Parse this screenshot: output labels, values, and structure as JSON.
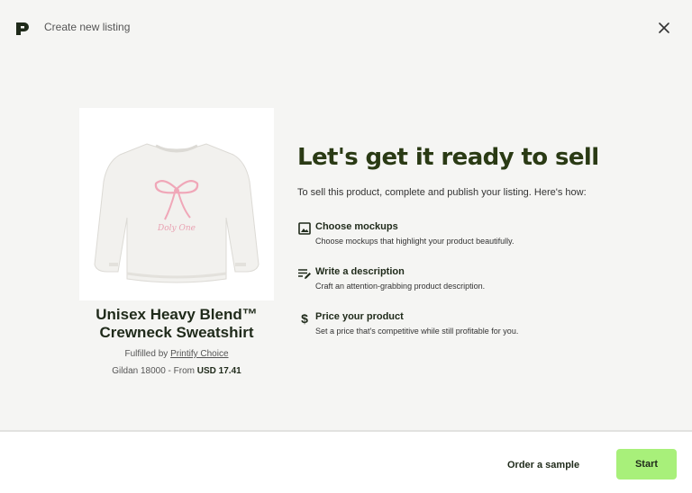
{
  "header": {
    "title": "Create new listing",
    "logo_icon": "printify-logo-icon",
    "close_icon": "close-icon"
  },
  "product": {
    "name": "Unisex Heavy Blend™ Crewneck Sweatshirt",
    "fulfilled_prefix": "Fulfilled by",
    "fulfilled_by": "Printify Choice",
    "price_prefix": "Gildan 18000 - From",
    "price": "USD 17.41",
    "image_text": "Doly One"
  },
  "main": {
    "title": "Let's get it ready to sell",
    "subtitle": "To sell this product, complete and publish your listing. Here's how:",
    "steps": [
      {
        "icon": "image-icon",
        "title": "Choose mockups",
        "description": "Choose mockups that highlight your product beautifully."
      },
      {
        "icon": "text-edit-icon",
        "title": "Write a description",
        "description": "Craft an attention-grabbing product description."
      },
      {
        "icon": "dollar-icon",
        "title": "Price your product",
        "description": "Set a price that's competitive while still profitable for you."
      }
    ]
  },
  "footer": {
    "order_sample_label": "Order a sample",
    "start_label": "Start"
  },
  "colors": {
    "background": "#f5f5f3",
    "accent": "#a8f07a",
    "text_dark": "#1f2a1a"
  }
}
